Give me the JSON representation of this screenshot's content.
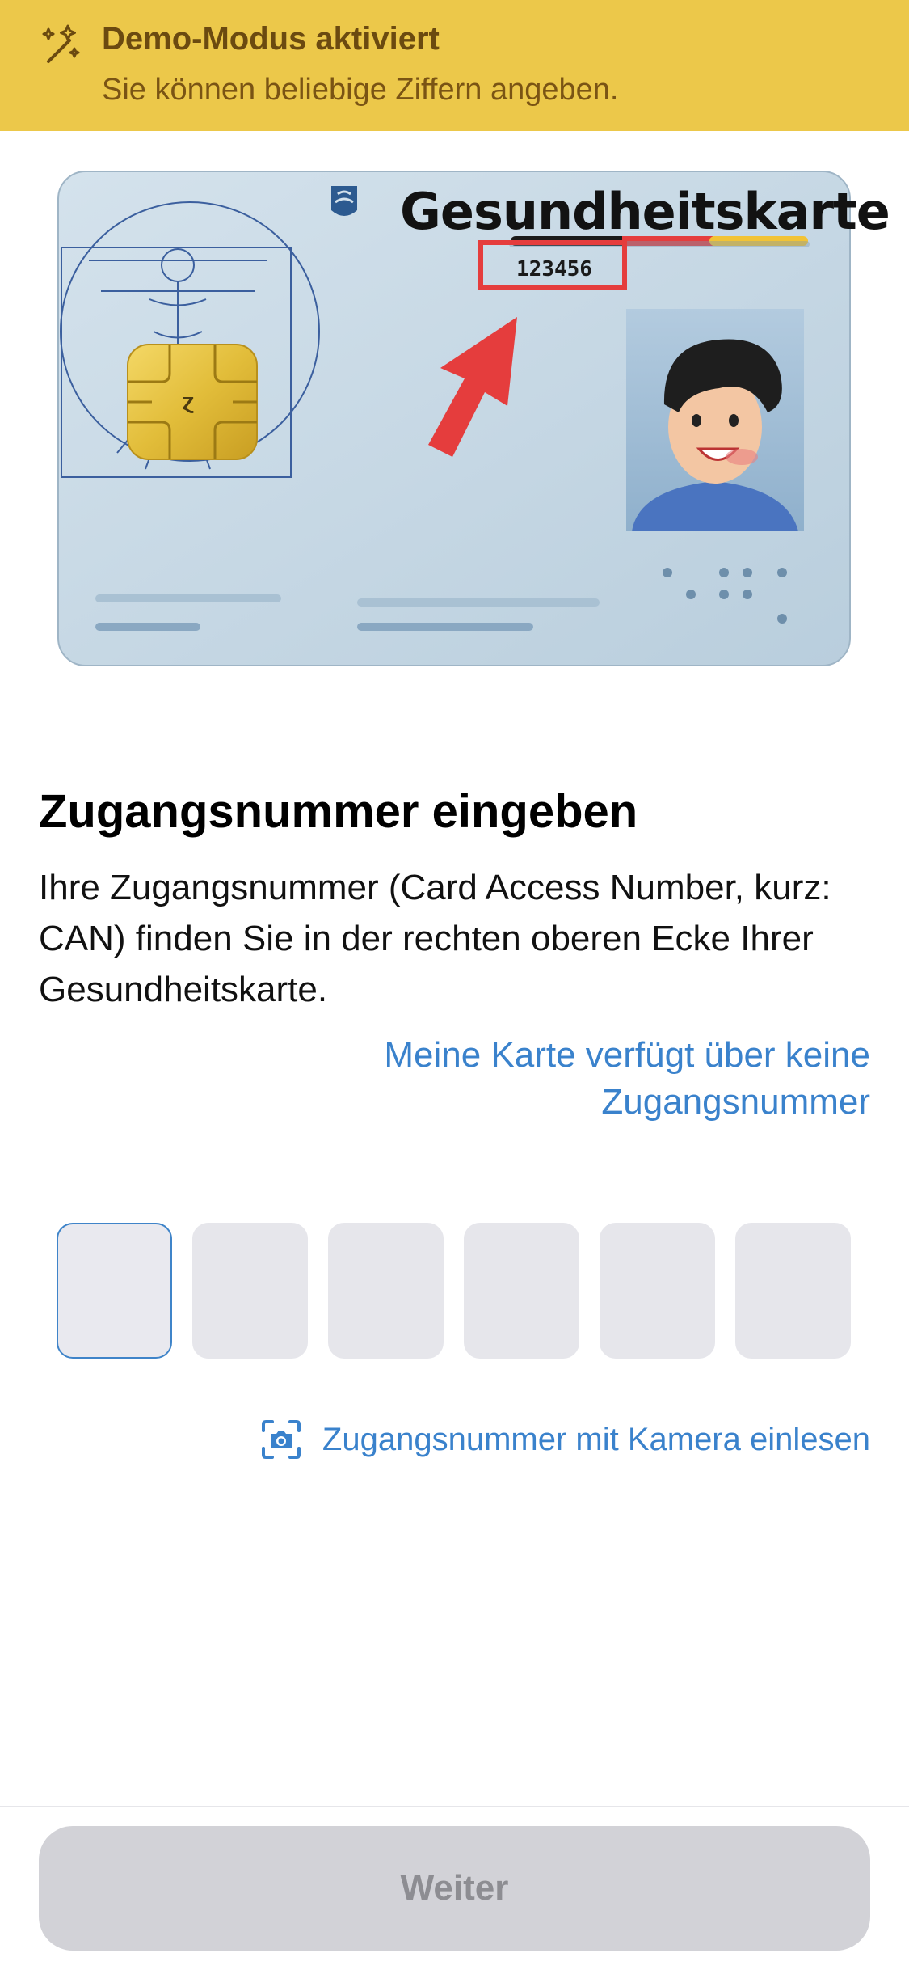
{
  "banner": {
    "icon": "sparkles-icon",
    "title": "Demo-Modus aktiviert",
    "subtitle": "Sie können beliebige Ziffern angeben."
  },
  "card": {
    "title": "Gesundheitskarte",
    "can_example": "123456"
  },
  "main": {
    "heading": "Zugangsnummer eingeben",
    "description": "Ihre Zugangsnummer (Card Access Number, kurz: CAN) finden Sie in der rechten oberen Ecke Ihrer Gesundheitskarte.",
    "no_can_link": "Meine Karte verfügt über keine Zugangsnummer",
    "digit_count": 6,
    "active_digit_index": 0,
    "camera_link": "Zugangsnummer mit Kamera einlesen"
  },
  "footer": {
    "continue_label": "Weiter"
  },
  "colors": {
    "banner": "#ecc84a",
    "link": "#3a82cc",
    "button_disabled": "#d2d2d7",
    "card_arrow": "#e53d3d"
  }
}
